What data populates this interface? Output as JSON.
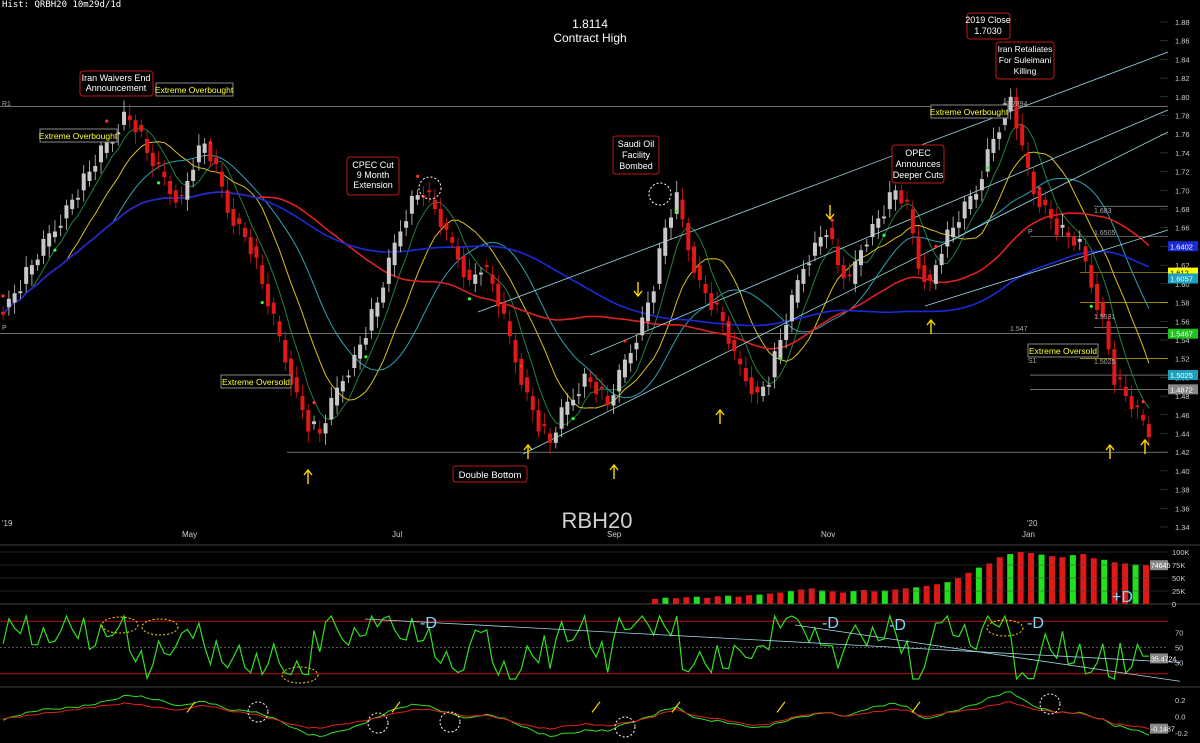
{
  "window": {
    "title": "Hist: QRBH20 10m29d/1d"
  },
  "symbol_watermark": "RBH20",
  "colors": {
    "background": "#000000",
    "up_candle": "#c8c8c8",
    "down_candle": "#e01818",
    "ema_red": "#e02020",
    "ma_blue": "#1a2ad8",
    "ma_teal": "#30a0b0",
    "ma_yellow": "#d8c020",
    "ma_green": "#208040",
    "trend_line": "#9ed8e8",
    "arrow_yellow": "#ffd800",
    "callout_border": "#c01818",
    "callout_text": "#ffffff",
    "label_yellow": "#ffff30",
    "rsi_line": "#30e020",
    "rsi_band": "#c01010",
    "divergence_text": "#7fd8ff"
  },
  "header_label": {
    "line1": "1.8114",
    "line2": "Contract High"
  },
  "price_axis": {
    "ticks": [
      "1.88",
      "1.86",
      "1.84",
      "1.82",
      "1.80",
      "1.78",
      "1.76",
      "1.74",
      "1.72",
      "1.70",
      "1.68",
      "1.66",
      "1.64",
      "1.62",
      "1.60",
      "1.58",
      "1.56",
      "1.54",
      "1.52",
      "1.50",
      "1.48",
      "1.46",
      "1.44",
      "1.42",
      "1.40",
      "1.38",
      "1.36",
      "1.34"
    ],
    "price_tags": [
      {
        "text": "1.612",
        "bg": "#ffff00",
        "fg": "#000000",
        "y": 1.612
      },
      {
        "text": "1.6057",
        "bg": "#1aa0c0",
        "fg": "#ffffff",
        "y": 1.6057
      },
      {
        "text": "1.6402",
        "bg": "#1a2ad8",
        "fg": "#ffffff",
        "y": 1.6402
      },
      {
        "text": "1.5467",
        "bg": "#20c020",
        "fg": "#ffffff",
        "y": 1.5467
      },
      {
        "text": "1.5025",
        "bg": "#1aa0c0",
        "fg": "#ffffff",
        "y": 1.5025
      },
      {
        "text": "1.4872",
        "bg": "#888888",
        "fg": "#ffffff",
        "y": 1.4872
      }
    ]
  },
  "date_axis": {
    "labels": [
      "'19",
      "May",
      "Jul",
      "Sep",
      "Nov",
      "'20",
      "Jan"
    ]
  },
  "level_labels": {
    "r1": "R1",
    "p_left": "P",
    "p_right": "P",
    "s1": "S1",
    "v1894": "1.7894",
    "v1547": "1.547",
    "v16505": "1.6505",
    "v1683": "1.683",
    "v1551": "1.5531",
    "v15025": "1.5025"
  },
  "annotations": {
    "iran_waivers": "Iran Waivers End\nAnnouncement",
    "extreme_overbought_1": "Extreme Overbought",
    "extreme_overbought_2": "Extreme Overbought",
    "extreme_overbought_3": "Extreme Overbought",
    "cpec": "CPEC Cut\n9 Month\nExtension",
    "saudi": "Saudi Oil\nFacility\nBombed",
    "opec": "OPEC\nAnnounces\nDeeper Cuts",
    "close2019": "2019 Close\n1.7030",
    "iran_retaliates": "Iran Retaliates\nFor Suleimani\nKilling",
    "extreme_oversold_1": "Extreme Oversold",
    "extreme_oversold_2": "Extreme Oversold",
    "double_bottom": "Double Bottom"
  },
  "volume_panel": {
    "ticks": [
      "100K",
      "75K",
      "50K",
      "25K",
      "0"
    ],
    "current_tag": "74645"
  },
  "rsi_panel": {
    "ticks": [
      "70",
      "50",
      "30"
    ],
    "current_tag": "35.4724",
    "divergence_labels": [
      "-D",
      "-D",
      "-D",
      "-D",
      "+D"
    ]
  },
  "momentum_panel": {
    "ticks": [
      "0.2",
      "0.0",
      "-0.2"
    ],
    "current_tag": "-0.1487"
  },
  "chart_data": {
    "type": "candlestick",
    "symbol": "RBH20",
    "title": "1.8114 Contract High",
    "ylim": [
      1.34,
      1.89
    ],
    "close_series_approx": [
      1.58,
      1.6,
      1.62,
      1.64,
      1.66,
      1.68,
      1.7,
      1.72,
      1.74,
      1.76,
      1.78,
      1.77,
      1.74,
      1.72,
      1.7,
      1.69,
      1.73,
      1.75,
      1.72,
      1.68,
      1.66,
      1.64,
      1.6,
      1.56,
      1.52,
      1.48,
      1.45,
      1.44,
      1.47,
      1.5,
      1.52,
      1.55,
      1.58,
      1.62,
      1.66,
      1.69,
      1.7,
      1.68,
      1.65,
      1.63,
      1.6,
      1.62,
      1.6,
      1.56,
      1.52,
      1.48,
      1.45,
      1.43,
      1.46,
      1.48,
      1.5,
      1.49,
      1.47,
      1.5,
      1.53,
      1.56,
      1.6,
      1.66,
      1.69,
      1.64,
      1.6,
      1.58,
      1.56,
      1.52,
      1.5,
      1.48,
      1.5,
      1.54,
      1.58,
      1.62,
      1.64,
      1.66,
      1.62,
      1.6,
      1.64,
      1.66,
      1.68,
      1.7,
      1.68,
      1.62,
      1.6,
      1.64,
      1.66,
      1.68,
      1.7,
      1.74,
      1.77,
      1.8,
      1.74,
      1.7,
      1.68,
      1.66,
      1.65,
      1.64,
      1.6,
      1.56,
      1.5,
      1.48,
      1.46,
      1.44
    ],
    "volume_values_approx_k": [
      10,
      12,
      11,
      13,
      14,
      12,
      15,
      16,
      14,
      17,
      18,
      20,
      22,
      25,
      28,
      30,
      26,
      24,
      22,
      25,
      27,
      24,
      26,
      28,
      30,
      32,
      35,
      38,
      42,
      50,
      60,
      70,
      78,
      90,
      96,
      100,
      98,
      95,
      92,
      90,
      94,
      96,
      88,
      85,
      80,
      78,
      76,
      74.645
    ],
    "rsi_ylim": [
      0,
      100
    ],
    "rsi_bands": [
      70,
      30
    ],
    "rsi_current": 35.4724,
    "momentum_current": -0.1487
  }
}
